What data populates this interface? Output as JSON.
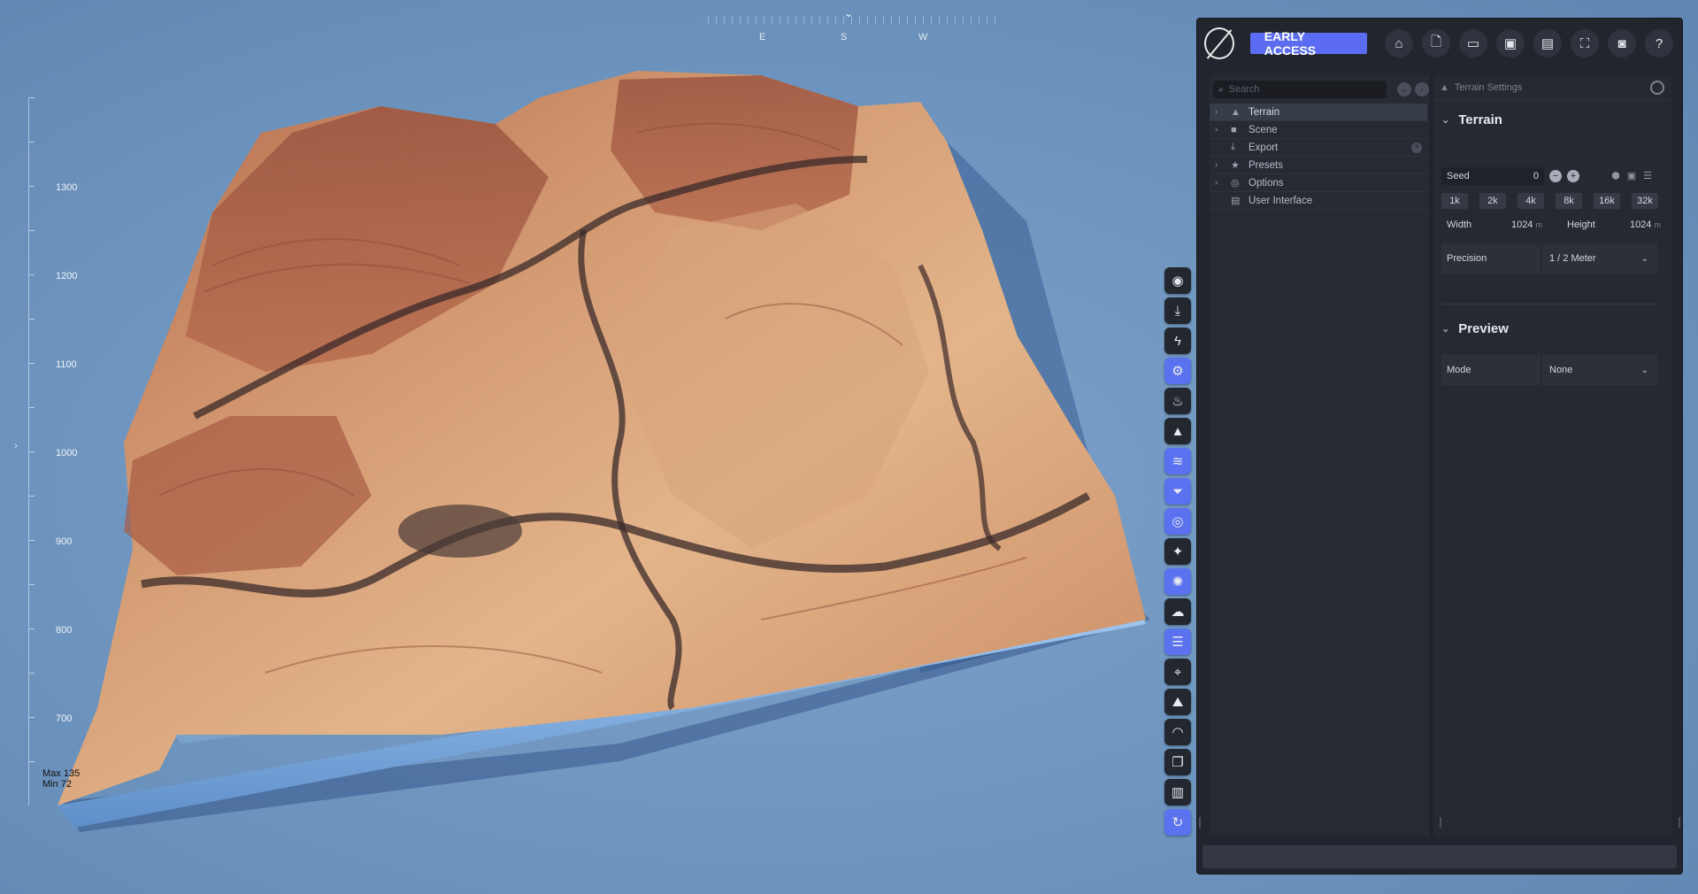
{
  "viewport": {
    "compass": {
      "letters": [
        "E",
        "S",
        "W"
      ],
      "needle": "⌄"
    },
    "ruler": {
      "labels": [
        "1300",
        "1200",
        "1100",
        "1000",
        "900",
        "800",
        "700"
      ],
      "max_label": "Max 135",
      "min_label": "Min 72"
    }
  },
  "toolbar": {
    "tools": [
      {
        "name": "target-tool-icon",
        "glyph": "◉",
        "active": false
      },
      {
        "name": "download-tool-icon",
        "glyph": "⤓",
        "active": false
      },
      {
        "name": "lightning-tool-icon",
        "glyph": "ϟ",
        "active": false
      },
      {
        "name": "cogs-tool-icon",
        "glyph": "⚙",
        "active": true
      },
      {
        "name": "fire-tool-icon",
        "glyph": "♨",
        "active": false
      },
      {
        "name": "mountain-tool-icon",
        "glyph": "▲",
        "active": false
      },
      {
        "name": "layers-tool-icon",
        "glyph": "≋",
        "active": true
      },
      {
        "name": "filter-tool-icon",
        "glyph": "⏷",
        "active": true
      },
      {
        "name": "eye-tool-icon",
        "glyph": "◎",
        "active": true
      },
      {
        "name": "sparkle-tool-icon",
        "glyph": "✦",
        "active": false
      },
      {
        "name": "sun-tool-icon",
        "glyph": "✺",
        "active": true
      },
      {
        "name": "cloud-tool-icon",
        "glyph": "☁",
        "active": false
      },
      {
        "name": "lines-tool-icon",
        "glyph": "☰",
        "active": true
      },
      {
        "name": "telescope-tool-icon",
        "glyph": "⌖",
        "active": false
      },
      {
        "name": "horizon-tool-icon",
        "glyph": "⛰",
        "active": false
      },
      {
        "name": "rainbow-tool-icon",
        "glyph": "◠",
        "active": false
      },
      {
        "name": "clone-tool-icon",
        "glyph": "❐",
        "active": false
      },
      {
        "name": "chart-tool-icon",
        "glyph": "▥",
        "active": false
      },
      {
        "name": "refresh-tool-icon",
        "glyph": "↻",
        "active": true
      }
    ]
  },
  "panel": {
    "badge": "EARLY ACCESS",
    "top_icons": [
      {
        "name": "home-icon",
        "glyph": "⌂"
      },
      {
        "name": "new-file-icon",
        "glyph": "🗋"
      },
      {
        "name": "open-folder-icon",
        "glyph": "▭"
      },
      {
        "name": "save-icon",
        "glyph": "▣"
      },
      {
        "name": "save-as-icon",
        "glyph": "▤"
      },
      {
        "name": "fullscreen-icon",
        "glyph": "⛶"
      },
      {
        "name": "camera-icon",
        "glyph": "◙"
      },
      {
        "name": "help-icon",
        "glyph": "?"
      }
    ],
    "tree": {
      "search_placeholder": "Search",
      "items": [
        {
          "label": "Terrain",
          "icon": "▲",
          "icon_name": "terrain-icon",
          "chevron": "›",
          "selected": true
        },
        {
          "label": "Scene",
          "icon": "■",
          "icon_name": "video-camera-icon",
          "chevron": "›",
          "selected": false
        },
        {
          "label": "Export",
          "icon": "⤓",
          "icon_name": "export-icon",
          "chevron": "",
          "selected": false,
          "add": true
        },
        {
          "label": "Presets",
          "icon": "★",
          "icon_name": "star-icon",
          "chevron": "›",
          "selected": false
        },
        {
          "label": "Options",
          "icon": "◎",
          "icon_name": "options-icon",
          "chevron": "›",
          "selected": false
        },
        {
          "label": "User Interface",
          "icon": "▤",
          "icon_name": "user-interface-icon",
          "chevron": "",
          "selected": false
        }
      ]
    },
    "settings": {
      "header": "Terrain Settings",
      "terrain_section": "Terrain",
      "seed_label": "Seed",
      "seed_value": "0",
      "resolutions": [
        "1k",
        "2k",
        "4k",
        "8k",
        "16k",
        "32k"
      ],
      "width_label": "Width",
      "width_value": "1024",
      "height_label": "Height",
      "height_value": "1024",
      "unit": "m",
      "precision_label": "Precision",
      "precision_value": "1 / 2 Meter",
      "preview_section": "Preview",
      "mode_label": "Mode",
      "mode_value": "None"
    }
  }
}
